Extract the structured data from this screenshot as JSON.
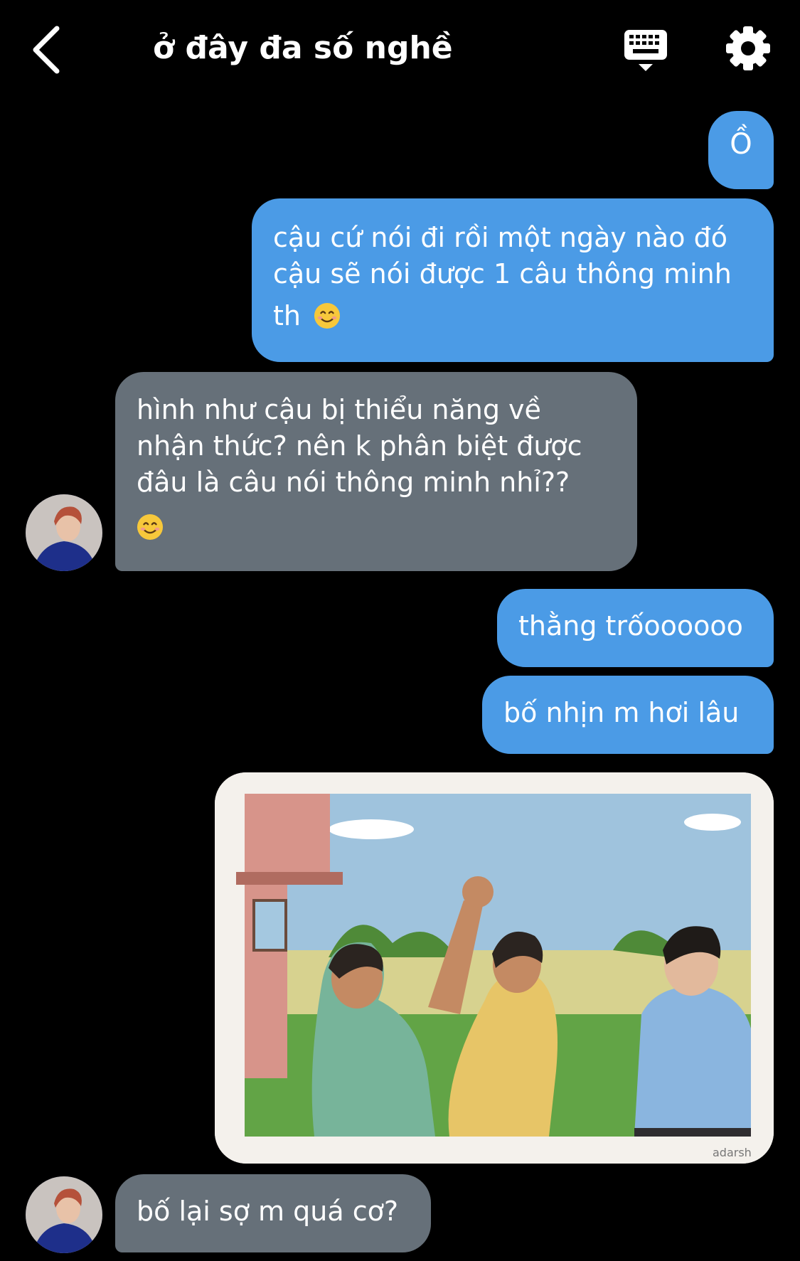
{
  "header": {
    "title": "ở đây đa số nghề",
    "back_icon": "chevron-left-icon",
    "keyboard_icon": "keyboard-icon",
    "settings_icon": "gear-icon"
  },
  "colors": {
    "outgoing": "#4b9be6",
    "incoming": "#667079",
    "background": "#000000"
  },
  "messages": [
    {
      "side": "out",
      "text": "Ồ"
    },
    {
      "side": "out",
      "lines": [
        "cậu cứ nói đi rồi một ngày nào đó",
        "cậu sẽ nói được 1 câu thông minh",
        "th"
      ],
      "emoji": "smiling-face-emoji"
    },
    {
      "side": "in",
      "lines": [
        "hình như cậu bị thiểu năng về",
        "nhận thức? nên k phân biệt được",
        "đâu là câu nói thông minh nhỉ??"
      ],
      "emoji": "smiling-face-emoji"
    },
    {
      "side": "out",
      "text": "thằng trốoooooo"
    },
    {
      "side": "out",
      "text": "bố nhịn m hơi lâu"
    },
    {
      "side": "out",
      "image": "illustration of a boy grabbing another boy's raised fist in a schoolyard while a third boy watches",
      "watermark": "adarsh"
    },
    {
      "side": "in",
      "text": "bố lại sợ m quá cơ?"
    }
  ]
}
